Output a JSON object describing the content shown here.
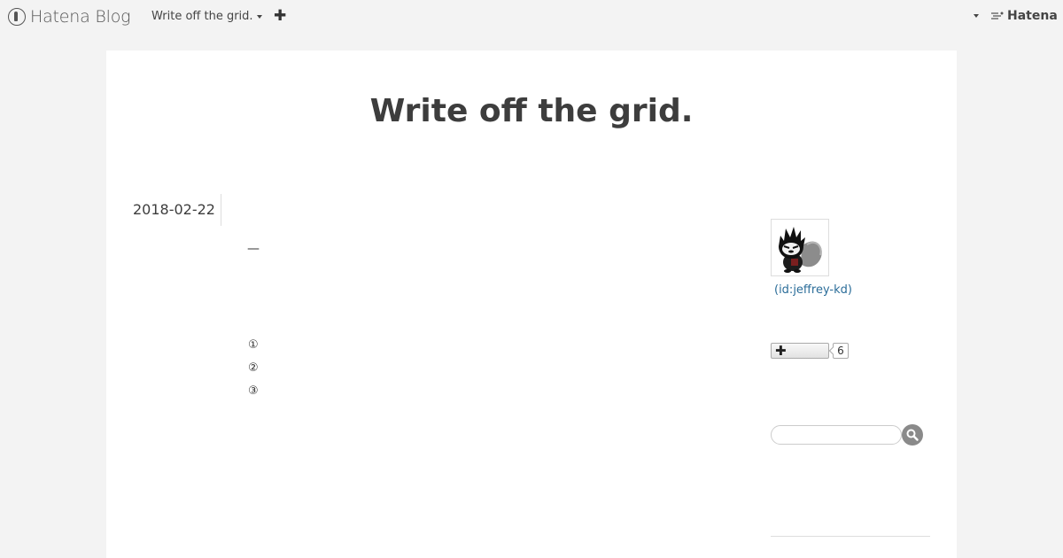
{
  "global_header": {
    "logo_text": "Hatena Blog",
    "blog_name": "Write off the grid.",
    "add_icon": "plus-icon",
    "account_menu_icon": "chevron-down-icon",
    "hatena_text": "Hatena"
  },
  "blog": {
    "title": "Write off the grid."
  },
  "entry": {
    "date": "2018-02-22",
    "dash": "—",
    "items": [
      "①",
      "②",
      "③"
    ]
  },
  "sidebar": {
    "profile": {
      "user_id": "(id:jeffrey-kd)"
    },
    "subscribe": {
      "button_icon": "plus-icon",
      "count": "6"
    },
    "search": {
      "placeholder": "",
      "button_icon": "search-icon"
    }
  },
  "colors": {
    "page_bg": "#f3f3f3",
    "content_bg": "#ffffff",
    "text": "#3d3d3d",
    "link": "#2b6d99",
    "search_button": "#8a8a8a"
  }
}
